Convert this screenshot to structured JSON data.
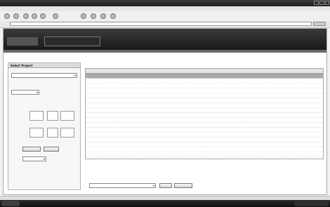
{
  "window": {
    "title": "",
    "buttons": [
      "minimize",
      "maximize",
      "close"
    ]
  },
  "menubar": {
    "items": []
  },
  "toolbar": {
    "icons": [
      "back-icon",
      "forward-icon",
      "stop-icon",
      "refresh-icon",
      "home-icon",
      "search-icon",
      "favorites-icon",
      "history-icon",
      "mail-icon",
      "print-icon"
    ]
  },
  "address": {
    "label": "",
    "value": "",
    "go_label": ""
  },
  "header": {
    "logo_text": "",
    "breadcrumb": ""
  },
  "left_panel": {
    "title": "Select Project",
    "project_select": "",
    "section1": "",
    "section1_value": "",
    "section2": "",
    "field_labels": [
      "",
      "",
      ""
    ],
    "buttons": [
      "",
      ""
    ],
    "bottom_select": ""
  },
  "right_panel": {
    "title": "",
    "columns": [
      "",
      "",
      ""
    ],
    "rows": [
      [
        "",
        "",
        ""
      ],
      [
        "",
        "",
        ""
      ],
      [
        "",
        "",
        ""
      ],
      [
        "",
        "",
        ""
      ],
      [
        "",
        "",
        ""
      ],
      [
        "",
        "",
        ""
      ],
      [
        "",
        "",
        ""
      ],
      [
        "",
        "",
        ""
      ],
      [
        "",
        "",
        ""
      ],
      [
        "",
        "",
        ""
      ],
      [
        "",
        "",
        ""
      ],
      [
        "",
        "",
        ""
      ],
      [
        "",
        "",
        ""
      ],
      [
        "",
        "",
        ""
      ],
      [
        "",
        "",
        ""
      ],
      [
        "",
        "",
        ""
      ],
      [
        "",
        "",
        ""
      ],
      [
        "",
        "",
        ""
      ]
    ],
    "bottom_label": "",
    "bottom_select": "",
    "bottom_buttons": [
      "",
      ""
    ]
  },
  "statusbar": {
    "text": ""
  },
  "taskbar": {
    "start": "",
    "tray": ""
  }
}
